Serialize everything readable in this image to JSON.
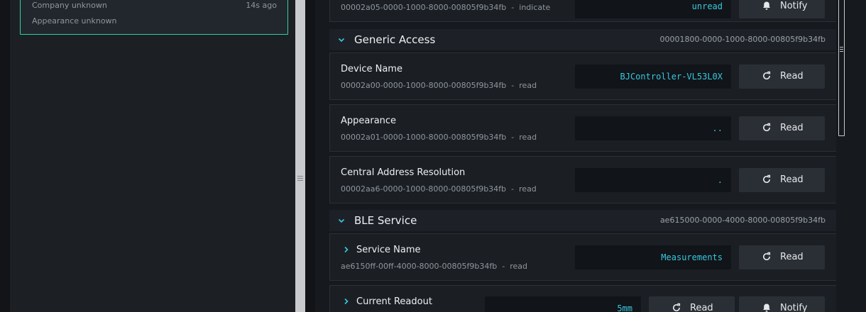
{
  "device": {
    "company": "Company unknown",
    "appearance": "Appearance unknown",
    "age": "14s ago"
  },
  "top_partial": {
    "uuid": "00002a05-0000-1000-8000-00805f9b34fb",
    "property": "indicate",
    "value": "unread",
    "button": "Notify"
  },
  "services": [
    {
      "title": "Generic Access",
      "uuid": "00001800-0000-1000-8000-00805f9b34fb",
      "characteristics": [
        {
          "name": "Device Name",
          "uuid": "00002a00-0000-1000-8000-00805f9b34fb",
          "property": "read",
          "value": "BJController-VL53L0X",
          "button": "Read"
        },
        {
          "name": "Appearance",
          "uuid": "00002a01-0000-1000-8000-00805f9b34fb",
          "property": "read",
          "value": "..",
          "button": "Read"
        },
        {
          "name": "Central Address Resolution",
          "uuid": "00002aa6-0000-1000-8000-00805f9b34fb",
          "property": "read",
          "value": ".",
          "button": "Read"
        }
      ]
    },
    {
      "title": "BLE Service",
      "uuid": "ae615000-0000-4000-8000-00805f9b34fb",
      "characteristics": [
        {
          "name": "Service Name",
          "uuid": "ae6150ff-00ff-4000-8000-00805f9b34fb",
          "property": "read",
          "value": "Measurements",
          "button": "Read"
        },
        {
          "name": "Current Readout",
          "value": "5mm",
          "button": "Read",
          "button2": "Notify"
        }
      ]
    }
  ],
  "separator": "-",
  "colors": {
    "accent": "#2fd3a4",
    "value_text": "#37c8e0",
    "chevron": "#37c8e0"
  },
  "icons": {
    "chevron": "chevron-down-icon",
    "chevron_right": "chevron-right-icon",
    "read": "refresh-icon",
    "notify": "bell-icon"
  }
}
